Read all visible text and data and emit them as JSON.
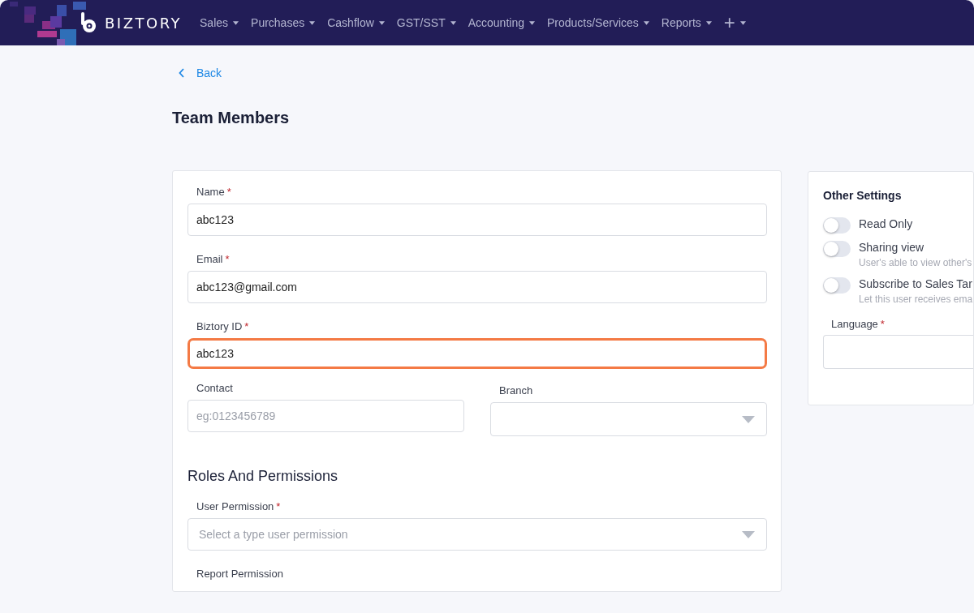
{
  "navbar": {
    "brand": "BIZTORY",
    "menu": [
      {
        "label": "Sales",
        "kind": "text"
      },
      {
        "label": "Purchases",
        "kind": "text"
      },
      {
        "label": "Cashflow",
        "kind": "text"
      },
      {
        "label": "GST/SST",
        "kind": "text"
      },
      {
        "label": "Accounting",
        "kind": "text"
      },
      {
        "label": "Products/Services",
        "kind": "text"
      },
      {
        "label": "Reports",
        "kind": "text"
      },
      {
        "label": "+",
        "kind": "plus"
      }
    ]
  },
  "back_link": "Back",
  "page_title": "Team Members",
  "form": {
    "fields": [
      {
        "label": "Name",
        "required_mark": "*",
        "value": "abc123",
        "highlighted": false
      },
      {
        "label": "Email",
        "required_mark": "*",
        "value": "abc123@gmail.com",
        "highlighted": false
      },
      {
        "label": "Biztory ID",
        "required_mark": "*",
        "value": "abc123",
        "highlighted": true
      }
    ],
    "contact": {
      "label": "Contact",
      "placeholder": "eg:0123456789"
    },
    "branch": {
      "label": "Branch"
    },
    "roles_heading": "Roles And Permissions",
    "user_permission": {
      "label": "User Permission",
      "required_mark": "*",
      "placeholder": "Select a type user permission"
    },
    "report_permission": {
      "label": "Report Permission"
    }
  },
  "other_settings": {
    "title": "Other Settings",
    "toggles": [
      {
        "label": "Read Only",
        "on": false
      },
      {
        "label": "Sharing view",
        "description": "User's able to view other's",
        "on": false
      },
      {
        "label": "Subscribe to Sales Tar",
        "description": "Let this user receives ema",
        "on": false
      }
    ],
    "language": {
      "label": "Language",
      "required_mark": "*"
    }
  }
}
